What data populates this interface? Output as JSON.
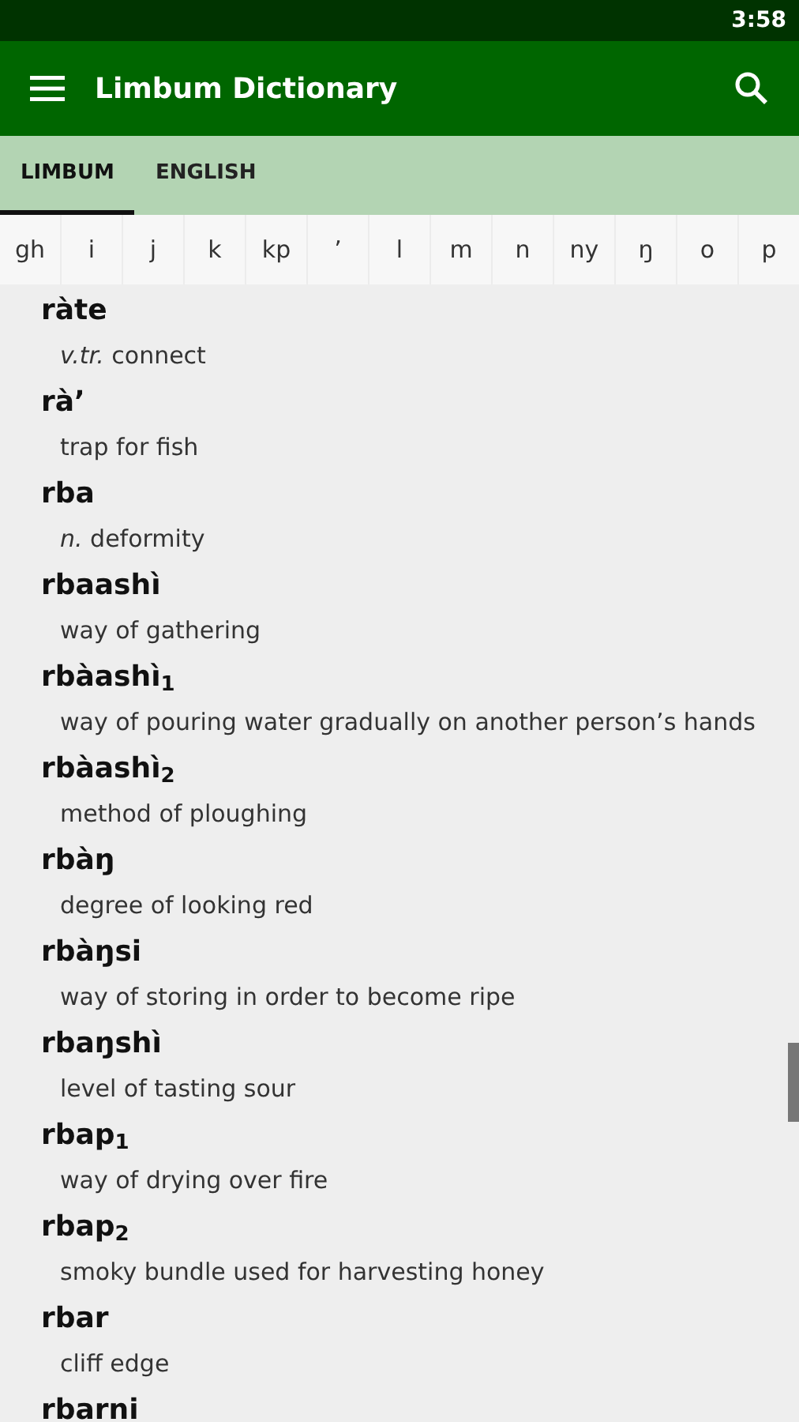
{
  "status_bar": {
    "time": "3:58"
  },
  "app_bar": {
    "title": "Limbum Dictionary"
  },
  "tabs": [
    {
      "label": "LIMBUM",
      "selected": true
    },
    {
      "label": "ENGLISH",
      "selected": false
    }
  ],
  "alphabet": [
    "gh",
    "i",
    "j",
    "k",
    "kp",
    "’",
    "l",
    "m",
    "n",
    "ny",
    "ŋ",
    "o",
    "p"
  ],
  "entries": [
    {
      "word": "ràte",
      "definition": "*v.tr.* connect"
    },
    {
      "word": "rà’",
      "definition": "trap for fish"
    },
    {
      "word": "rba",
      "definition": "*n.* deformity"
    },
    {
      "word": "rbaashì",
      "definition": "way of gathering"
    },
    {
      "word": "rbàashì$_{1}$",
      "definition": "way of pouring water gradually on another person’s hands"
    },
    {
      "word": "rbàashì$_{2}$",
      "definition": "method of ploughing"
    },
    {
      "word": "rbàŋ",
      "definition": "degree of looking red"
    },
    {
      "word": "rbàŋsi",
      "definition": "way of storing in order to become ripe"
    },
    {
      "word": "rbaŋshì",
      "definition": "level of tasting sour"
    },
    {
      "word": "rbap$_{1}$",
      "definition": "way of drying over fire"
    },
    {
      "word": "rbap$_{2}$",
      "definition": "smoky bundle used for harvesting honey"
    },
    {
      "word": "rbar",
      "definition": "cliff edge"
    },
    {
      "word": "rbarni"
    }
  ]
}
